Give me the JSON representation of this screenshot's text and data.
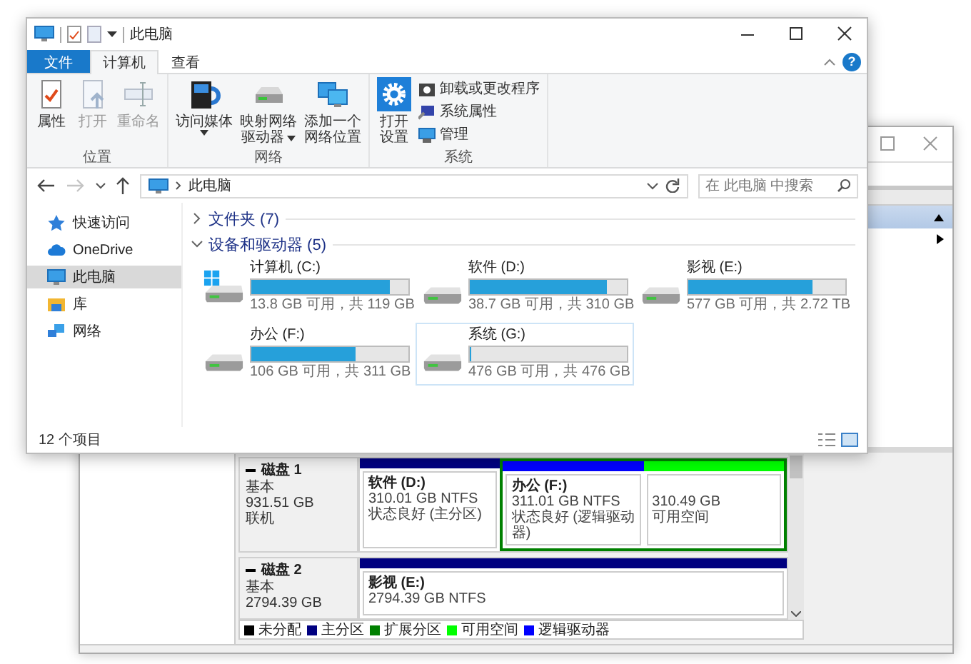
{
  "disk_management": {
    "disks": [
      {
        "name": "磁盘 1",
        "type": "基本",
        "size": "931.51 GB",
        "status": "联机",
        "partitions": [
          {
            "kind": "primary",
            "color": "#000080",
            "name": "软件 (D:)",
            "size": "310.01 GB NTFS",
            "status": "状态良好 (主分区)"
          },
          {
            "kind": "extended",
            "color": "#008000",
            "children": [
              {
                "kind": "logical",
                "color": "#0000ff",
                "name": "办公 (F:)",
                "size": "311.01 GB NTFS",
                "status": "状态良好 (逻辑驱动器)"
              },
              {
                "kind": "free",
                "color": "#00ff00",
                "size": "310.49 GB",
                "status": "可用空间"
              }
            ]
          }
        ]
      },
      {
        "name": "磁盘 2",
        "type": "基本",
        "size": "2794.39 GB",
        "partitions": [
          {
            "kind": "primary",
            "color": "#000080",
            "name": "影视 (E:)",
            "size": "2794.39 GB NTFS"
          }
        ]
      }
    ],
    "legend": [
      {
        "label": "未分配",
        "color": "#000000"
      },
      {
        "label": "主分区",
        "color": "#000080"
      },
      {
        "label": "扩展分区",
        "color": "#008000"
      },
      {
        "label": "可用空间",
        "color": "#00ff00"
      },
      {
        "label": "逻辑驱动器",
        "color": "#0000ff"
      }
    ]
  },
  "explorer": {
    "title": "此电脑",
    "help": "?",
    "tabs": [
      {
        "label": "文件",
        "kind": "file",
        "selected": false
      },
      {
        "label": "计算机",
        "kind": "tab",
        "selected": true
      },
      {
        "label": "查看",
        "kind": "tab",
        "selected": false
      }
    ],
    "ribbon": [
      {
        "label": "位置",
        "commands": [
          {
            "kind": "properties",
            "lines": [
              "属性"
            ],
            "disabled": false,
            "dropdown": false
          },
          {
            "kind": "open",
            "lines": [
              "打开"
            ],
            "disabled": true,
            "dropdown": false
          },
          {
            "kind": "rename",
            "lines": [
              "重命名"
            ],
            "disabled": true,
            "dropdown": false
          }
        ]
      },
      {
        "label": "网络",
        "commands": [
          {
            "kind": "media",
            "lines": [
              "访问媒体"
            ],
            "disabled": false,
            "dropdown": true
          },
          {
            "kind": "map-drive",
            "lines": [
              "映射网络",
              "驱动器"
            ],
            "disabled": false,
            "dropdown": true
          },
          {
            "kind": "add-location",
            "lines": [
              "添加一个",
              "网络位置"
            ],
            "disabled": false,
            "dropdown": false
          }
        ]
      },
      {
        "label": "系统",
        "commands": [
          {
            "kind": "settings",
            "lines": [
              "打开",
              "设置"
            ],
            "disabled": false,
            "dropdown": false
          }
        ],
        "small_commands": [
          {
            "kind": "uninstall",
            "label": "卸载或更改程序"
          },
          {
            "kind": "system-properties",
            "label": "系统属性"
          },
          {
            "kind": "manage",
            "label": "管理"
          }
        ]
      }
    ],
    "nav": {
      "back_disabled": false,
      "forward_disabled": true
    },
    "address": {
      "path": "此电脑",
      "search_placeholder": "在 此电脑 中搜索"
    },
    "sidebar": [
      {
        "label": "快速访问",
        "kind": "quick",
        "selected": false
      },
      {
        "label": "OneDrive",
        "kind": "cloud",
        "selected": false
      },
      {
        "label": "此电脑",
        "kind": "pc",
        "selected": true
      },
      {
        "label": "库",
        "kind": "library",
        "selected": false
      },
      {
        "label": "网络",
        "kind": "network",
        "selected": false
      }
    ],
    "sections": [
      {
        "label": "文件夹 (7)",
        "expanded": false
      },
      {
        "label": "设备和驱动器 (5)",
        "expanded": true,
        "drives": [
          {
            "name": "计算机 (C:)",
            "kind": "system",
            "level": 0.88,
            "space": "13.8 GB 可用，共 119 GB",
            "selected": false
          },
          {
            "name": "软件 (D:)",
            "kind": "local",
            "level": 0.875,
            "space": "38.7 GB 可用，共 310 GB",
            "selected": false
          },
          {
            "name": "影视 (E:)",
            "kind": "local",
            "level": 0.79,
            "space": "577 GB 可用，共 2.72 TB",
            "selected": false
          },
          {
            "name": "办公 (F:)",
            "kind": "local",
            "level": 0.66,
            "space": "106 GB 可用，共 311 GB",
            "selected": false
          },
          {
            "name": "系统 (G:)",
            "kind": "local",
            "level": 0,
            "space": "476 GB 可用，共 476 GB",
            "selected": true
          }
        ]
      }
    ],
    "status": "12 个项目"
  }
}
